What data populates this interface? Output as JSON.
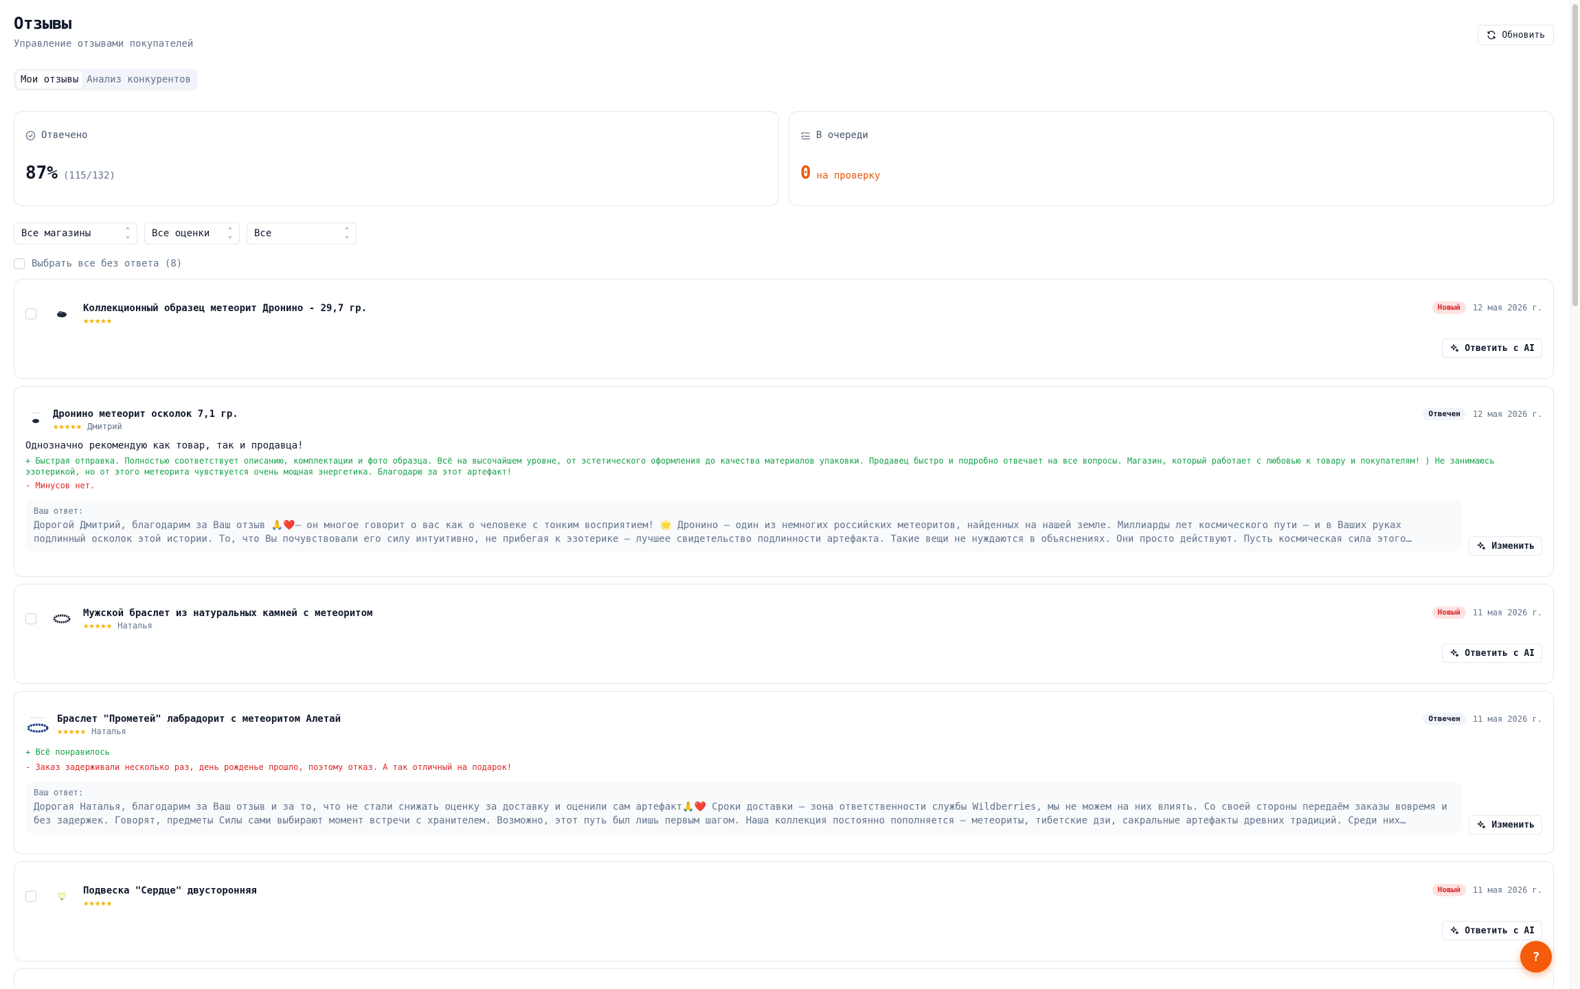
{
  "header": {
    "title": "Отзывы",
    "subtitle": "Управление отзывами покупателей",
    "refresh_label": "Обновить"
  },
  "tabs": [
    {
      "label": "Мои отзывы",
      "active": true
    },
    {
      "label": "Анализ конкурентов",
      "active": false
    }
  ],
  "stats": {
    "answered": {
      "label": "Отвечено",
      "percent": "87%",
      "detail": "(115/132)"
    },
    "queue": {
      "label": "В очереди",
      "count": "0",
      "detail": "на проверку"
    }
  },
  "filters": {
    "store": "Все магазины",
    "rating": "Все оценки",
    "status": "Все"
  },
  "select_all_label": "Выбрать все без ответа (8)",
  "reviews": [
    {
      "product": "Коллекционный образец метеорит Дронино - 29,7 гр.",
      "stars": "★★★★★",
      "author": "",
      "badge": "Новый",
      "date": "12 мая 2026 г.",
      "action": "Ответить с AI"
    },
    {
      "product": "Дронино метеорит осколок 7,1 гр.",
      "stars": "★★★★★",
      "author": "Дмитрий",
      "badge": "Отвечен",
      "date": "12 мая 2026 г.",
      "text": "Однозначно рекомендую как товар, так и продавца!",
      "pros": "+ Быстрая отправка. Полностью соответствует описанию, комплектации и фото образца. Всё на высочайшем уровне, от эстетического оформления до качества материалов упаковки. Продавец быстро и подробно отвечает на все вопросы. Магазин, который работает с любовью к товару и покупателям! ) Не занимаюсь эзотерикой, но от этого метеорита чувствуется очень мощная энергетика. Благодарю за этот артефакт!",
      "cons": "- Минусов нет.",
      "answer_label": "Ваш ответ:",
      "answer": "Дорогой Дмитрий, благодарим за Ваш отзыв 🙏❤️— он многое говорит о вас как о человеке с тонким восприятием! 🌟 Дронино — один из немногих российских метеоритов, найденных на нашей земле. Миллиарды лет космического пути — и в Ваших руках подлинный осколок этой истории. То, что Вы почувствовали его силу интуитивно, не прибегая к эзотерике — лучшее свидетельство подлинности артефакта. Такие вещи не нуждаются в объяснениях. Они просто действуют. Пусть космическая сила этого метеорита сопровождает Вас.",
      "action": "Изменить"
    },
    {
      "product": "Мужской браслет из натуральных камней с метеоритом",
      "stars": "★★★★★",
      "author": "Наталья",
      "badge": "Новый",
      "date": "11 мая 2026 г.",
      "action": "Ответить с AI"
    },
    {
      "product": "Браслет \"Прометей\" лабрадорит с метеоритом Алетай",
      "stars": "★★★★★",
      "author": "Наталья",
      "badge": "Отвечен",
      "date": "11 мая 2026 г.",
      "pros": "+ Всё понравилось",
      "cons": "- Заказ задерживали несколько раз, день рожденье прошло, поэтому отказ. А так отличный на подарок!",
      "answer_label": "Ваш ответ:",
      "answer": "Дорогая Наталья, благодарим за Ваш отзыв и за то, что не стали снижать оценку за доставку и оценили сам артефакт🙏❤️ Сроки доставки — зона ответственности службы Wildberries, мы не можем на них влиять. Со своей стороны передаём заказы вовремя и без задержек. Говорят, предметы Силы сами выбирают момент встречи с хранителем. Возможно, этот путь был лишь первым шагом. Наша коллекция постоянно пополняется — метеориты, тибетские дзи, сакральные артефакты древних традиций. Среди них обязательно найдётся то, что отзовётся Вам.",
      "action": "Изменить"
    },
    {
      "product": "Подвеска \"Сердце\" двусторонняя",
      "stars": "★★★★★",
      "author": "",
      "badge": "Новый",
      "date": "11 мая 2026 г.",
      "action": "Ответить с AI"
    }
  ],
  "help_label": "?",
  "colors": {
    "accent": "#f45b0b",
    "new_badge": "#dc2626",
    "pros": "#16a34a",
    "cons": "#dc2626",
    "star": "#f5b301"
  }
}
